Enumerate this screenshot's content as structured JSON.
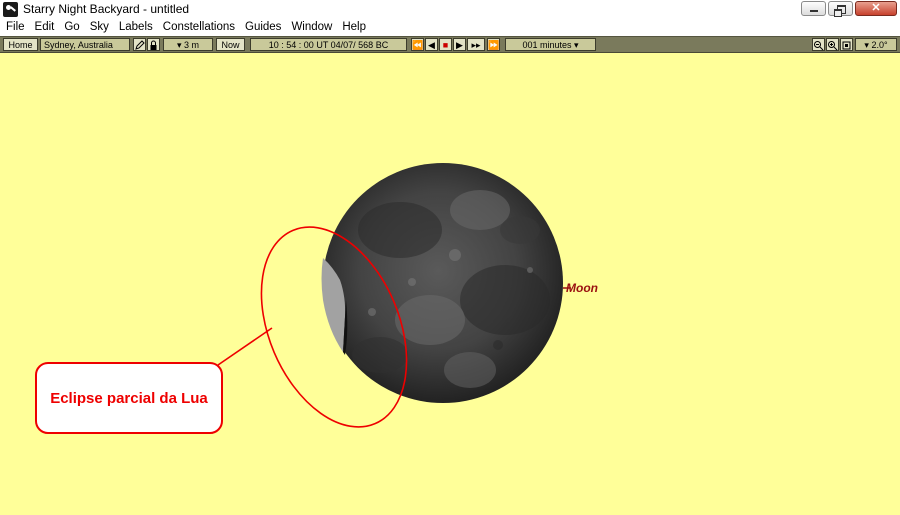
{
  "window": {
    "title": "Starry Night Backyard - untitled",
    "close_glyph": "✕"
  },
  "menu": [
    "File",
    "Edit",
    "Go",
    "Sky",
    "Labels",
    "Constellations",
    "Guides",
    "Window",
    "Help"
  ],
  "toolbar": {
    "home_label": "Home",
    "location": "Sydney, Australia",
    "elevation": "▾ 3 m",
    "now_label": "Now",
    "datetime": "10 : 54 : 00  UT    04/07/   568 BC",
    "timestep": "001 minutes ▾",
    "fov": "▾ 2.0°",
    "transport": [
      "⏪",
      "◀",
      "■",
      "▶",
      "▸▸",
      "⏩"
    ],
    "transport_icons": [
      "fast-backward-icon",
      "step-backward-icon",
      "stop-icon",
      "play-icon",
      "step-forward-icon",
      "fast-forward-icon"
    ]
  },
  "sky": {
    "object_label": "Moon",
    "annotation": "Eclipse parcial da Lua",
    "colors": {
      "sky_background": "#ffff99",
      "annotation_red": "#ee0000",
      "label_color": "#9a1010",
      "toolbar": "#7a7a5c"
    }
  }
}
